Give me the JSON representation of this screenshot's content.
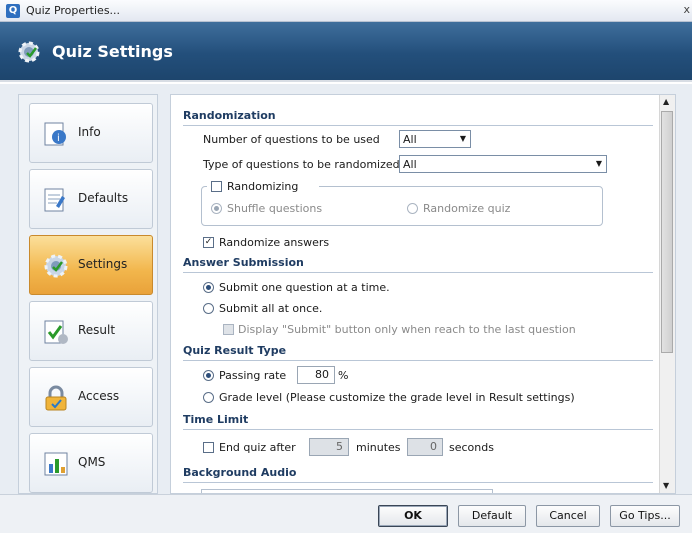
{
  "window": {
    "title": "Quiz Properties...",
    "close_glyph": "x",
    "app_icon": "Q"
  },
  "header": {
    "title": "Quiz Settings"
  },
  "sidebar": {
    "items": [
      {
        "label": "Info",
        "icon": "info-icon"
      },
      {
        "label": "Defaults",
        "icon": "defaults-icon"
      },
      {
        "label": "Settings",
        "icon": "settings-gear-icon",
        "active": true
      },
      {
        "label": "Result",
        "icon": "result-icon"
      },
      {
        "label": "Access",
        "icon": "lock-icon"
      },
      {
        "label": "QMS",
        "icon": "qms-chart-icon"
      }
    ]
  },
  "randomization": {
    "heading": "Randomization",
    "num_questions_label": "Number of questions to be used",
    "num_questions_value": "All",
    "type_label": "Type of questions to be randomized",
    "type_value": "All",
    "randomizing_label": "Randomizing",
    "shuffle_label": "Shuffle questions",
    "randomize_quiz_label": "Randomize quiz",
    "randomize_answers_label": "Randomize answers",
    "randomize_answers_checked": "✓"
  },
  "answer_submission": {
    "heading": "Answer Submission",
    "one_at_a_time": "Submit one question at a time.",
    "all_at_once": "Submit all at once.",
    "display_submit": "Display \"Submit\" button  only when reach to the last question"
  },
  "quiz_result": {
    "heading": "Quiz Result Type",
    "passing_rate_label": "Passing rate",
    "passing_rate_value": "80",
    "percent": "%",
    "grade_level_label": "Grade level (Please customize the grade level in Result settings)"
  },
  "time_limit": {
    "heading": "Time Limit",
    "end_quiz_label": "End quiz after",
    "minutes_value": "5",
    "minutes_label": "minutes",
    "seconds_value": "0",
    "seconds_label": "seconds"
  },
  "background_audio": {
    "heading": "Background Audio"
  },
  "buttons": {
    "ok": "OK",
    "default": "Default",
    "cancel": "Cancel",
    "go_tips": "Go Tips..."
  },
  "colors": {
    "header_bg": "#234f7b",
    "active_tab": "#f2b64c",
    "section_heading": "#1f3c62"
  }
}
